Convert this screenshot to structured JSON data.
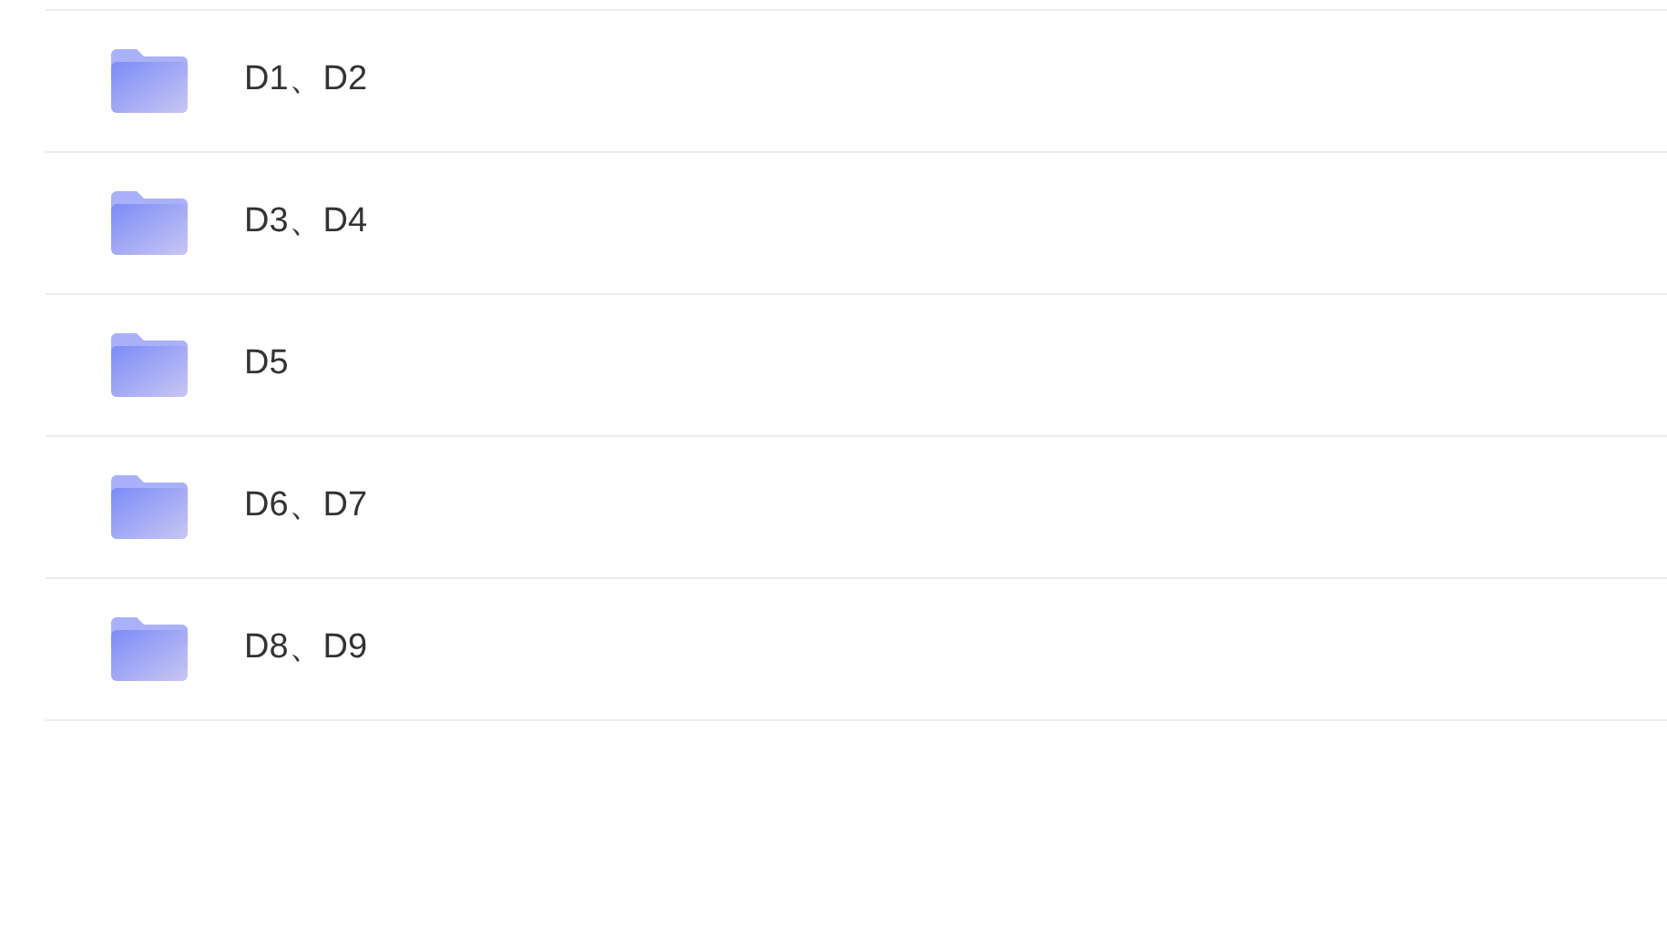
{
  "folders": [
    {
      "name": "D1、D2"
    },
    {
      "name": "D3、D4"
    },
    {
      "name": "D5"
    },
    {
      "name": "D6、D7"
    },
    {
      "name": "D8、D9"
    }
  ]
}
